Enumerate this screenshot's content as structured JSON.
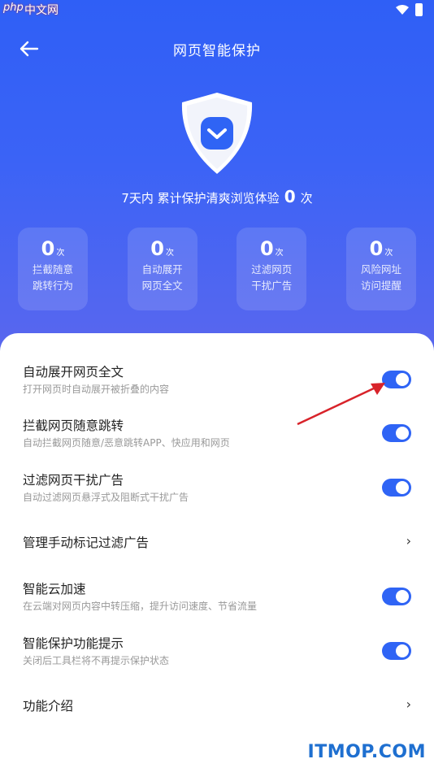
{
  "statusbar": {
    "logo": "php",
    "text": "中文网"
  },
  "header": {
    "title": "网页智能保护"
  },
  "summary": {
    "prefix": "7天内 累计保护清爽浏览体验",
    "count": "0",
    "suffix": "次"
  },
  "stats": [
    {
      "value": "0",
      "unit": "次",
      "line1": "拦截随意",
      "line2": "跳转行为"
    },
    {
      "value": "0",
      "unit": "次",
      "line1": "自动展开",
      "line2": "网页全文"
    },
    {
      "value": "0",
      "unit": "次",
      "line1": "过滤网页",
      "line2": "干扰广告"
    },
    {
      "value": "0",
      "unit": "次",
      "line1": "风险网址",
      "line2": "访问提醒"
    }
  ],
  "settings": [
    {
      "title": "自动展开网页全文",
      "sub": "打开网页时自动展开被折叠的内容",
      "toggle_on": true
    },
    {
      "title": "拦截网页随意跳转",
      "sub": "自动拦截网页随意/恶意跳转APP、快应用和网页",
      "toggle_on": true
    },
    {
      "title": "过滤网页干扰广告",
      "sub": "自动过滤网页悬浮式及阻断式干扰广告",
      "toggle_on": true
    },
    {
      "title": "管理手动标记过滤广告",
      "chevron": "›"
    },
    {
      "title": "智能云加速",
      "sub": "在云端对网页内容中转压缩，提升访问速度、节省流量",
      "toggle_on": true
    },
    {
      "title": "智能保护功能提示",
      "sub": "关闭后工具栏将不再提示保护状态",
      "toggle_on": true
    },
    {
      "title": "功能介绍",
      "chevron": "›"
    }
  ],
  "watermark": "ITMOP.COM",
  "colors": {
    "accent": "#2f64f5",
    "hero_top": "#2f5ff6",
    "hero_bottom": "#5a67ee",
    "annotation_arrow": "#d8232a"
  }
}
